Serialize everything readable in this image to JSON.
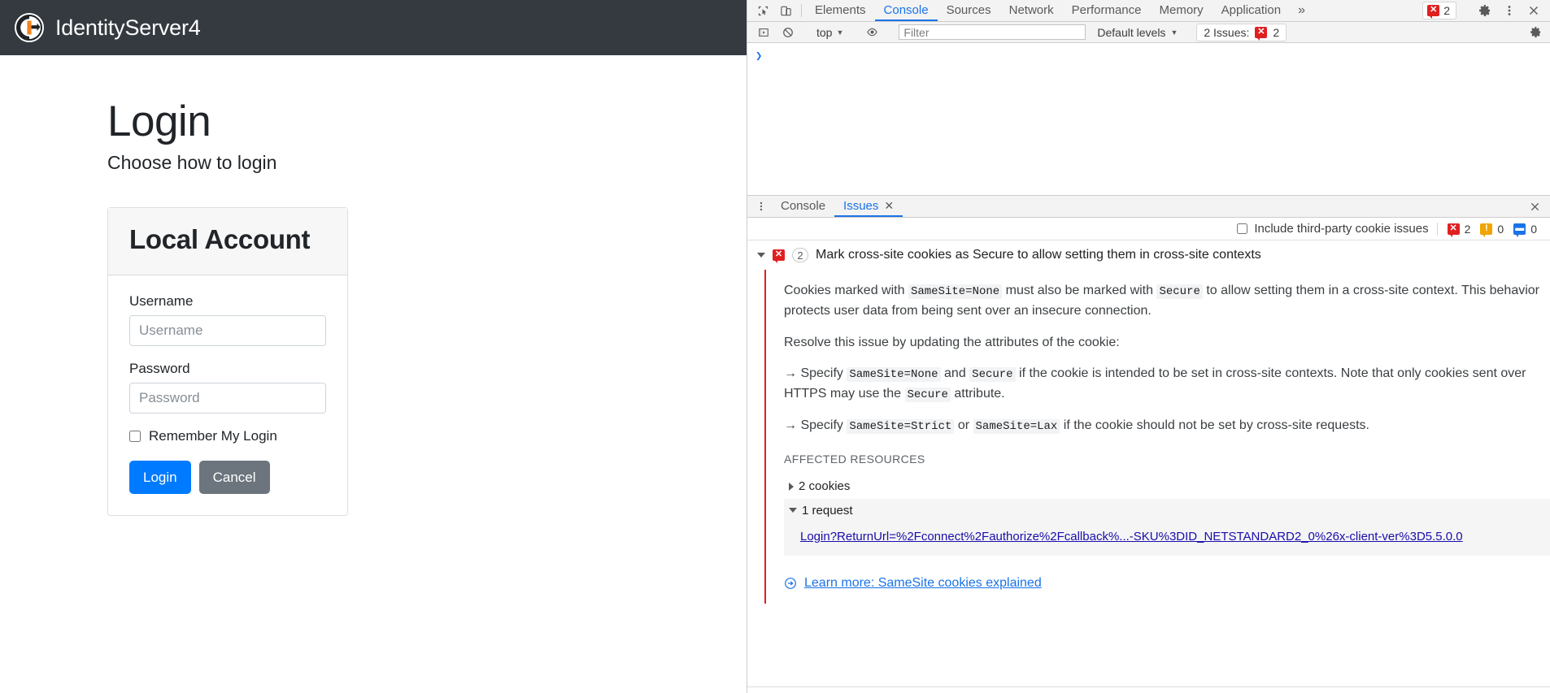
{
  "app": {
    "brand": "IdentityServer4",
    "logo_icon": "identityserver-logo-icon"
  },
  "login_page": {
    "title": "Login",
    "lead": "Choose how to login",
    "card": {
      "header": "Local Account",
      "username_label": "Username",
      "username_placeholder": "Username",
      "username_value": "",
      "password_label": "Password",
      "password_placeholder": "Password",
      "password_value": "",
      "remember_label": "Remember My Login",
      "remember_checked": false,
      "login_button": "Login",
      "cancel_button": "Cancel",
      "primary_color": "#007bff",
      "secondary_color": "#6c757d"
    }
  },
  "devtools": {
    "icons": {
      "inspect": "inspect-element-icon",
      "device": "device-toolbar-icon",
      "more_tabs": "more-tabs-icon",
      "settings": "gear-icon",
      "menu": "kebab-menu-icon",
      "close": "close-icon",
      "console_sidebar": "console-sidebar-icon",
      "clear_console": "clear-console-icon",
      "eye": "live-expression-eye-icon",
      "prompt": "console-prompt-icon"
    },
    "tabs": [
      {
        "label": "Elements",
        "active": false
      },
      {
        "label": "Console",
        "active": true
      },
      {
        "label": "Sources",
        "active": false
      },
      {
        "label": "Network",
        "active": false
      },
      {
        "label": "Performance",
        "active": false
      },
      {
        "label": "Memory",
        "active": false
      },
      {
        "label": "Application",
        "active": false
      }
    ],
    "more_tabs_glyph": "»",
    "error_pill_count": "2",
    "filter_bar": {
      "context": "top",
      "filter_placeholder": "Filter",
      "filter_value": "",
      "levels": "Default levels",
      "issues_label": "2 Issues:",
      "issues_count": "2"
    },
    "drawer": {
      "tabs": [
        {
          "label": "Console",
          "active": false,
          "closable": false
        },
        {
          "label": "Issues",
          "active": true,
          "closable": true
        }
      ],
      "toolbar": {
        "third_party_label": "Include third-party cookie issues",
        "third_party_checked": false,
        "error_count": "2",
        "warning_count": "0",
        "info_count": "0"
      },
      "issue": {
        "title": "Mark cross-site cookies as Secure to allow setting them in cross-site contexts",
        "count": "2",
        "expanded": true,
        "paragraphs": [
          {
            "parts": [
              {
                "t": "Cookies marked with "
              },
              {
                "t": "SameSite=None",
                "code": true
              },
              {
                "t": " must also be marked with "
              },
              {
                "t": "Secure",
                "code": true
              },
              {
                "t": " to allow setting them in a cross-site context. This behavior protects user data from being sent over an insecure connection."
              }
            ]
          },
          {
            "parts": [
              {
                "t": "Resolve this issue by updating the attributes of the cookie:"
              }
            ]
          },
          {
            "parts": [
              {
                "t": "→ Specify "
              },
              {
                "t": "SameSite=None",
                "code": true
              },
              {
                "t": " and "
              },
              {
                "t": "Secure",
                "code": true
              },
              {
                "t": " if the cookie is intended to be set in cross-site contexts. Note that only cookies sent over HTTPS may use the "
              },
              {
                "t": "Secure",
                "code": true
              },
              {
                "t": " attribute."
              }
            ]
          },
          {
            "parts": [
              {
                "t": "→ Specify "
              },
              {
                "t": "SameSite=Strict",
                "code": true
              },
              {
                "t": " or "
              },
              {
                "t": "SameSite=Lax",
                "code": true
              },
              {
                "t": " if the cookie should not be set by cross-site requests."
              }
            ]
          }
        ],
        "affected_resources_title": "AFFECTED RESOURCES",
        "resources": [
          {
            "label": "2 cookies",
            "expanded": false
          },
          {
            "label": "1 request",
            "expanded": true
          }
        ],
        "request_link": "Login?ReturnUrl=%2Fconnect%2Fauthorize%2Fcallback%...-SKU%3DID_NETSTANDARD2_0%26x-client-ver%3D5.5.0.0",
        "learn_more": "Learn more: SameSite cookies explained"
      }
    }
  }
}
